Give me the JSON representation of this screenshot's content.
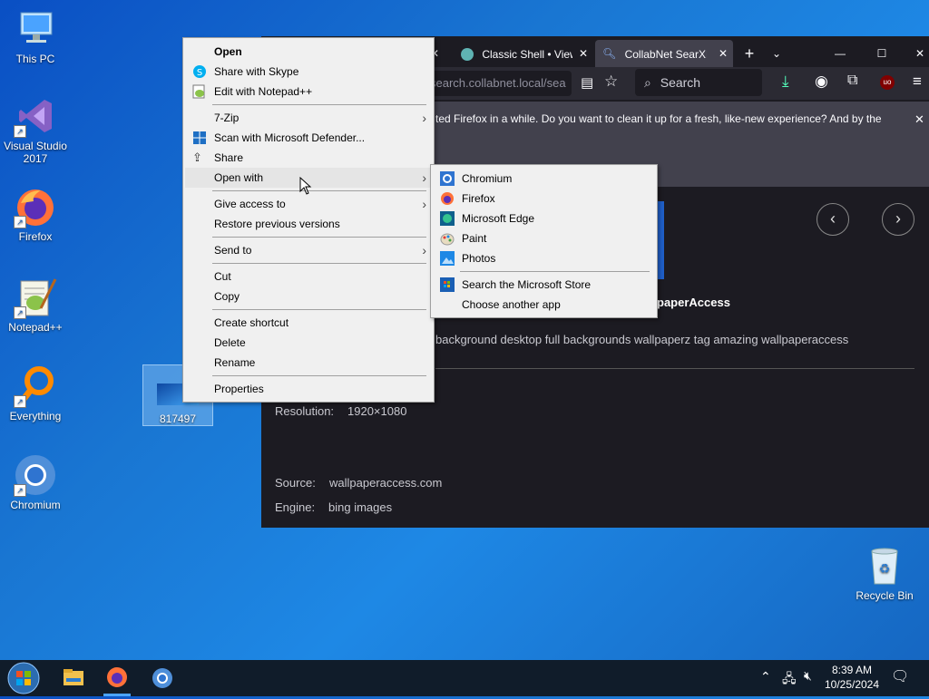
{
  "desktop": {
    "icons": [
      {
        "label": "This PC"
      },
      {
        "label": "Visual Studio 2017"
      },
      {
        "label": "Firefox"
      },
      {
        "label": "Notepad++"
      },
      {
        "label": "Everything"
      },
      {
        "label": "Chromium"
      },
      {
        "label": "817497"
      },
      {
        "label": "Recycle Bin"
      }
    ]
  },
  "browser": {
    "tabs": [
      {
        "title": "Classic Shell • View"
      },
      {
        "title": "CollabNet SearXNG"
      }
    ],
    "url": "search.collabnet.local/sea",
    "search_placeholder": "Search",
    "notification": "ted Firefox in a while. Do you want to clean it up for a fresh, like-new experience? And by the",
    "result": {
      "title_fragment": "paperAccess",
      "description": "background desktop full backgrounds wallpaperz tag amazing wallpaperaccess",
      "resolution_label": "Resolution:",
      "resolution_value": "1920×1080",
      "source_label": "Source:",
      "source_value": "wallpaperaccess.com",
      "engine_label": "Engine:",
      "engine_value": "bing images"
    }
  },
  "context_menu": {
    "items": [
      {
        "label": "Open"
      },
      {
        "label": "Share with Skype"
      },
      {
        "label": "Edit with Notepad++"
      },
      {
        "label": "7-Zip"
      },
      {
        "label": "Scan with Microsoft Defender..."
      },
      {
        "label": "Share"
      },
      {
        "label": "Open with"
      },
      {
        "label": "Give access to"
      },
      {
        "label": "Restore previous versions"
      },
      {
        "label": "Send to"
      },
      {
        "label": "Cut"
      },
      {
        "label": "Copy"
      },
      {
        "label": "Create shortcut"
      },
      {
        "label": "Delete"
      },
      {
        "label": "Rename"
      },
      {
        "label": "Properties"
      }
    ]
  },
  "open_with_menu": {
    "items": [
      {
        "label": "Chromium"
      },
      {
        "label": "Firefox"
      },
      {
        "label": "Microsoft Edge"
      },
      {
        "label": "Paint"
      },
      {
        "label": "Photos"
      },
      {
        "label": "Search the Microsoft Store"
      },
      {
        "label": "Choose another app"
      }
    ]
  },
  "taskbar": {
    "time": "8:39 AM",
    "date": "10/25/2024"
  },
  "colors": {
    "desktop_blue": "#1976d2",
    "browser_dark": "#1c1b22",
    "menu_bg": "#f0f0f0",
    "taskbar": "#101c2a"
  }
}
